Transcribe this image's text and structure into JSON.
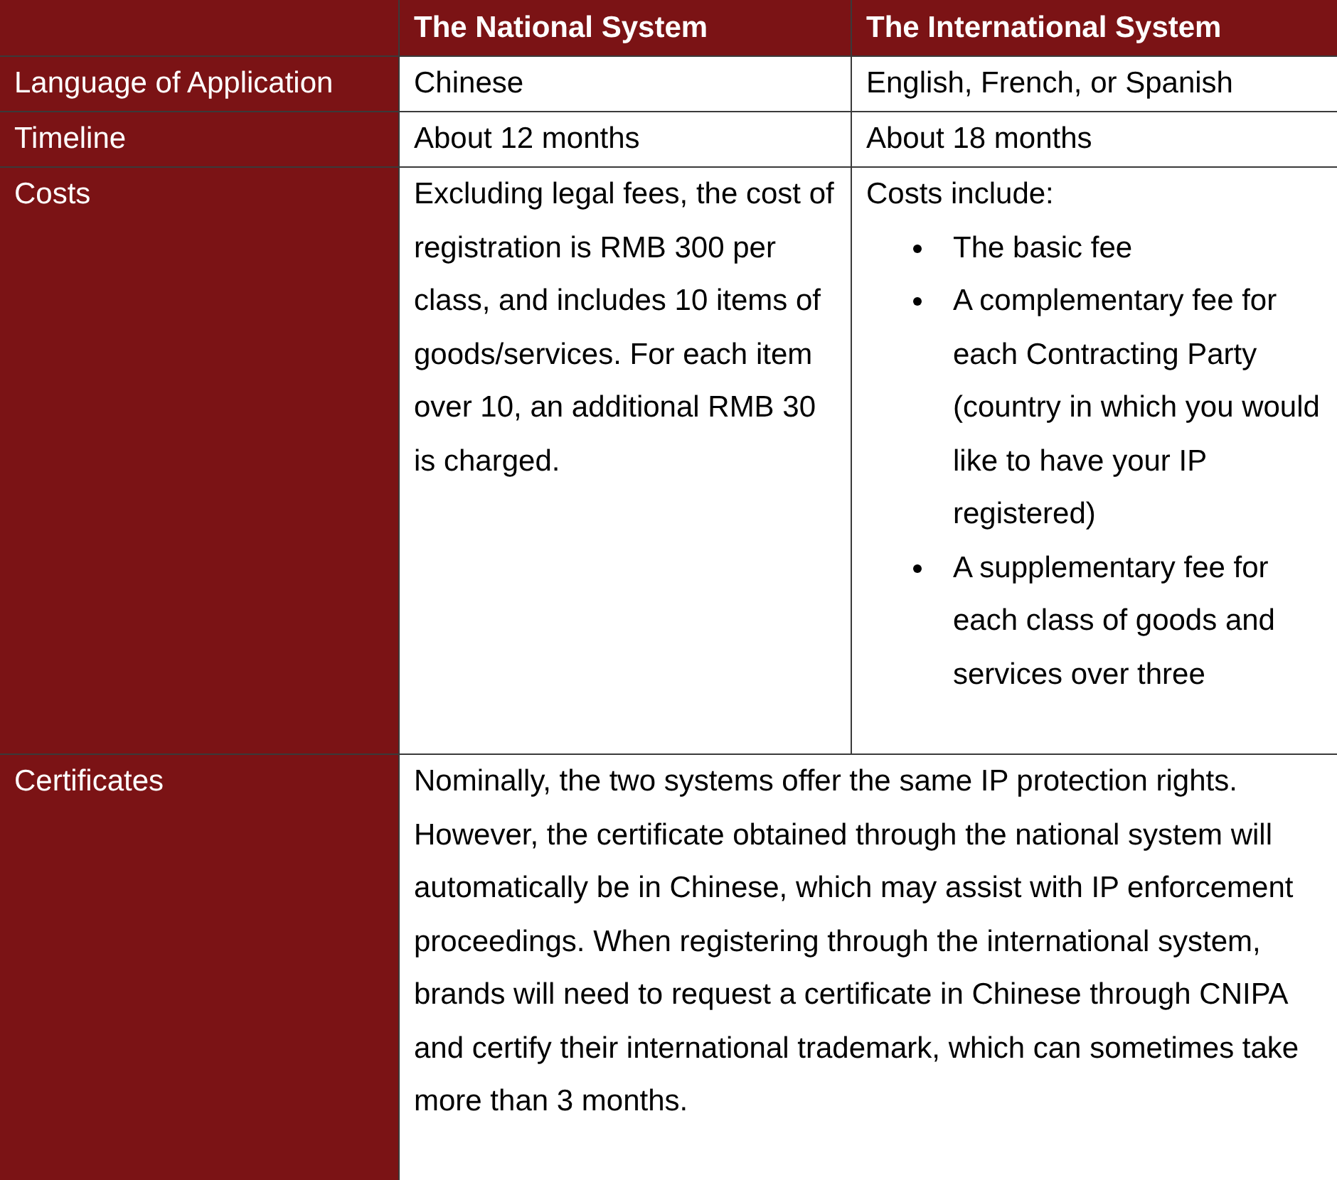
{
  "table": {
    "columns": [
      "The National System",
      "The International System"
    ],
    "rows": [
      {
        "label": "Language of Application",
        "cells": [
          {
            "kind": "text",
            "text": "Chinese"
          },
          {
            "kind": "text",
            "text": "English, French, or Spanish"
          }
        ]
      },
      {
        "label": "Timeline",
        "cells": [
          {
            "kind": "text",
            "text": "About 12 months"
          },
          {
            "kind": "text",
            "text": "About 18 months"
          }
        ]
      },
      {
        "label": "Costs",
        "cells": [
          {
            "kind": "text",
            "text": "Excluding legal fees, the cost of registration is RMB 300 per class, and includes 10 items of goods/services. For each item over 10, an additional RMB 30 is charged."
          },
          {
            "kind": "list",
            "intro": "Costs include:",
            "items": [
              "The basic fee",
              "A complementary fee for each Contracting Party (country in which you would like to have your IP registered)",
              "A supplementary fee for each class of goods and services over three"
            ]
          }
        ]
      },
      {
        "label": "Certificates",
        "cells": [
          {
            "kind": "text",
            "text": "Nominally, the two systems offer the same IP protection rights. However, the certificate obtained through the national system will automatically be in Chinese, which may assist with IP enforcement proceedings. When registering through the international system, brands will need to request a certificate in Chinese through CNIPA and certify their international trademark, which can sometimes take more than 3 months."
          }
        ]
      }
    ]
  }
}
